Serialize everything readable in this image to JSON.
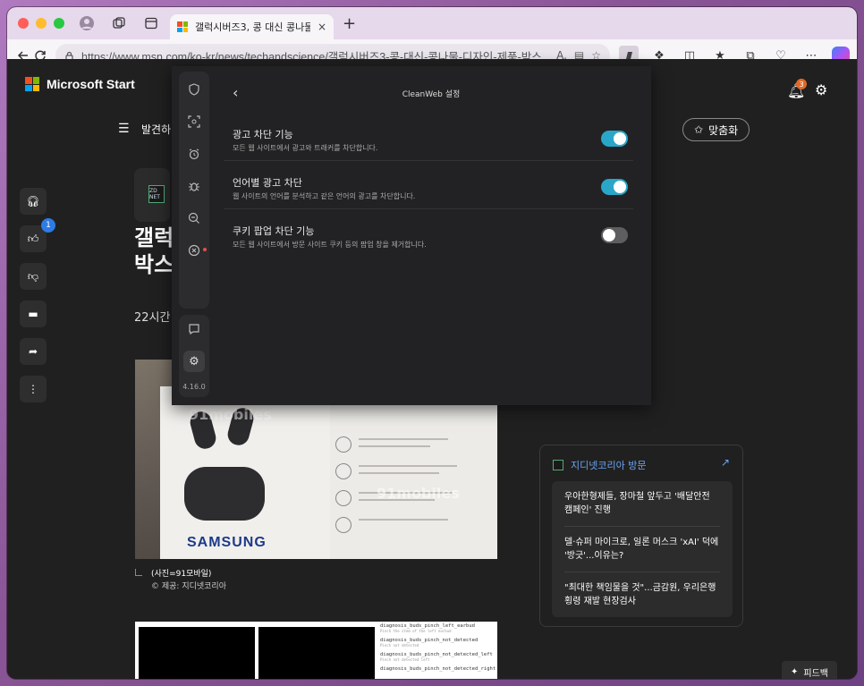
{
  "browser": {
    "tab_title": "갤럭시버즈3, 콩 대신 콩나물 디자인",
    "tab_close": "×",
    "new_tab": "+",
    "url": "https://www.msn.com/ko-kr/news/techandscience/갤럭시버즈3-콩-대신-콩나물-디자인-제품-박스..."
  },
  "page": {
    "brand": "Microsoft Start",
    "notification_count": "3",
    "nav_discover": "발견하",
    "personalize_label": "맞춤화",
    "like_count": "1",
    "headline_line1": "갤럭",
    "headline_line2": "박스",
    "time": "22시간",
    "source_logo": "ZD NET",
    "caption": "(사진=91모바일)",
    "credit": "© 제공: 지디넷코리아",
    "photo": {
      "brand": "SAMSUNG",
      "watermark1": "91mobiles",
      "watermark2": "91mobiles"
    },
    "diagnostics": [
      {
        "title": "diagnosis_buds_pinch_left_earbud",
        "sub": "Pinch the stem of the left earbud"
      },
      {
        "title": "diagnosis_buds_pinch_not_detected",
        "sub": "Pinch not detected"
      },
      {
        "title": "diagnosis_buds_pinch_not_detected_left",
        "sub": "Pinch not detected left"
      },
      {
        "title": "diagnosis_buds_pinch_not_detected_right",
        "sub": ""
      }
    ],
    "visit": {
      "title": "지디넷코리아 방문",
      "items": [
        "우아한형제들, 장마철 앞두고 '배달안전 캠페인' 진행",
        "델·슈퍼 마이크로, 일론 머스크 'xAI' 덕에 '방긋'...이유는?",
        "\"최대한 책임물을 것\"...금감원, 우리은행 횡령 재발 현장검사"
      ]
    },
    "feedback_label": "피드백"
  },
  "cleanweb": {
    "title": "CleanWeb 설정",
    "version": "4.16.0",
    "settings": [
      {
        "title": "광고 차단 기능",
        "desc": "모든 웹 사이트에서 광고와 트래커를 차단합니다.",
        "enabled": true
      },
      {
        "title": "언어별 광고 차단",
        "desc": "웹 사이트의 언어를 분석하고 같은 언어의 광고를 차단합니다.",
        "enabled": true
      },
      {
        "title": "쿠키 팝업 차단 기능",
        "desc": "모든 웹 사이트에서 방문 사이트 쿠키 등의 팝업 창을 제거합니다.",
        "enabled": false
      }
    ]
  },
  "colors": {
    "toggle_on": "#2aa6c8",
    "accent_link": "#6aa6f5",
    "badge_blue": "#2d7be5",
    "badge_orange": "#e06a2a"
  },
  "icons": {
    "back": "arrow-left-icon",
    "reload": "reload-icon",
    "lock": "lock-icon",
    "bell": "bell-icon",
    "gear": "gear-icon",
    "headphones": "headphones-icon",
    "thumbs_up": "thumbs-up-icon",
    "thumbs_down": "thumbs-down-icon",
    "comment": "comment-icon",
    "share": "share-icon",
    "more": "more-vertical-icon"
  }
}
